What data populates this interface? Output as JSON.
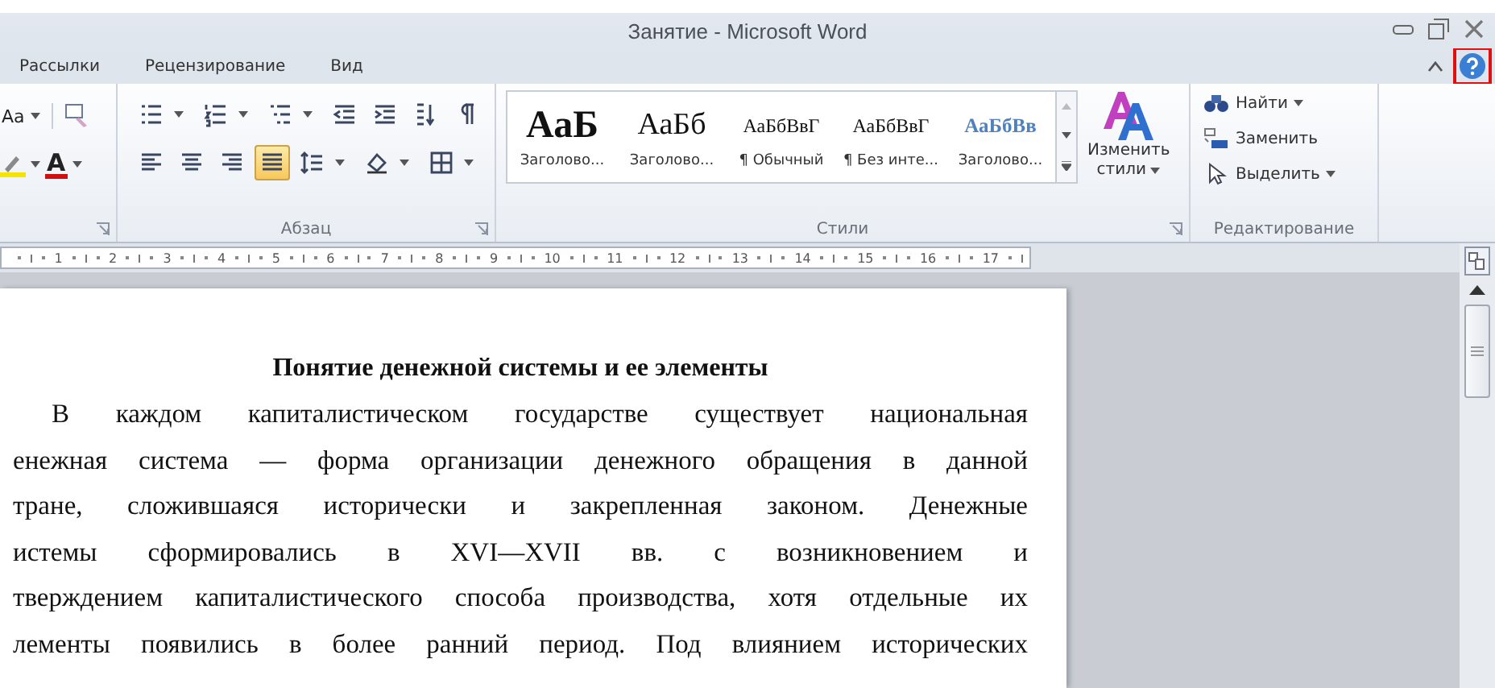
{
  "window": {
    "title": "Занятие - Microsoft Word"
  },
  "tabs": [
    {
      "label": "Рассылки",
      "selected": false
    },
    {
      "label": "Рецензирование",
      "selected": false
    },
    {
      "label": "Вид",
      "selected": false
    }
  ],
  "help": {
    "highlighted": true
  },
  "ribbon": {
    "font_group": {
      "change_case": "Аа",
      "font_color": "А"
    },
    "paragraph_group": {
      "label": "Абзац",
      "rows": [
        [
          {
            "kind": "bullets",
            "menu": true,
            "selected": false
          },
          {
            "kind": "numbering",
            "menu": true,
            "selected": false
          },
          {
            "kind": "multilevel",
            "menu": true,
            "selected": false
          },
          {
            "kind": "outdent",
            "menu": false,
            "selected": false
          },
          {
            "kind": "indent",
            "menu": false,
            "selected": false
          },
          {
            "kind": "sort",
            "menu": false,
            "selected": false
          },
          {
            "kind": "pilcrow",
            "menu": false,
            "selected": false
          }
        ],
        [
          {
            "kind": "align-left",
            "menu": false,
            "selected": false
          },
          {
            "kind": "align-center",
            "menu": false,
            "selected": false
          },
          {
            "kind": "align-right",
            "menu": false,
            "selected": false
          },
          {
            "kind": "justify",
            "menu": false,
            "selected": true
          },
          {
            "kind": "line-spacing",
            "menu": true,
            "selected": false
          },
          {
            "kind": "shading",
            "menu": true,
            "selected": false
          },
          {
            "kind": "borders",
            "menu": true,
            "selected": false
          }
        ]
      ]
    },
    "styles_group": {
      "label": "Стили",
      "change_styles": [
        "Изменить",
        "стили"
      ],
      "styles": [
        {
          "preview": "АаБ",
          "name": "Заголово...",
          "kind": "heading1"
        },
        {
          "preview": "АаБб",
          "name": "Заголово...",
          "kind": "heading2"
        },
        {
          "preview": "АаБбВвГ",
          "name": "¶ Обычный",
          "kind": "normal"
        },
        {
          "preview": "АаБбВвГ",
          "name": "¶ Без инте...",
          "kind": "normal"
        },
        {
          "preview": "АаБбВв",
          "name": "Заголово...",
          "kind": "title"
        }
      ]
    },
    "editing_group": {
      "label": "Редактирование",
      "items": [
        {
          "label": "Найти",
          "kind": "find",
          "menu": true
        },
        {
          "label": "Заменить",
          "kind": "replace",
          "menu": false
        },
        {
          "label": "Выделить",
          "kind": "select",
          "menu": true
        }
      ]
    }
  },
  "ruler": {
    "numbers": [
      "1",
      "2",
      "3",
      "4",
      "5",
      "6",
      "7",
      "8",
      "9",
      "10",
      "11",
      "12",
      "13",
      "14",
      "15",
      "16",
      "17"
    ]
  },
  "document": {
    "heading": "Понятие денежной системы и ее элементы",
    "lines": [
      {
        "text": "В каждом капиталистическом государстве существует национальная",
        "indent": true
      },
      {
        "text": "енежная система — форма организации денежного обращения в данной",
        "indent": false
      },
      {
        "text": "тране, сложившаяся исторически и закрепленная законом. Денежные",
        "indent": false
      },
      {
        "text": "истемы сформировались в XVI—XVII вв. с возникновением и",
        "indent": false
      },
      {
        "text": "тверждением капиталистического способа производства, хотя отдельные их",
        "indent": false
      },
      {
        "text": "лементы появились в более ранний период. Под влиянием исторических",
        "indent": false
      }
    ]
  }
}
